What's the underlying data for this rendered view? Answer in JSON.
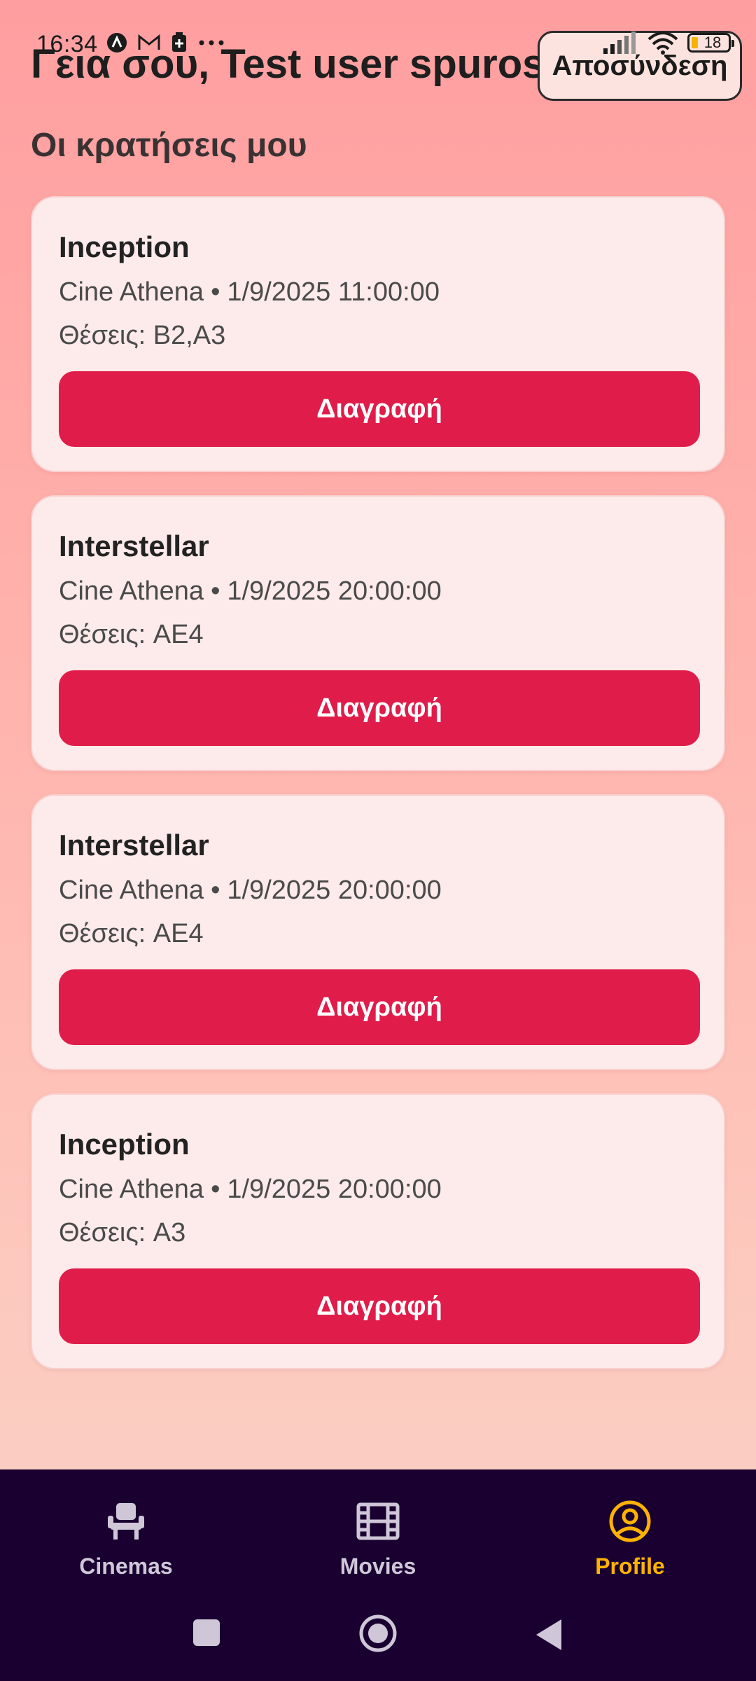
{
  "status": {
    "time": "16:34",
    "battery": "18"
  },
  "header": {
    "greeting": "Γεια σου, Test user spuros",
    "logout_label": "Αποσύνδεση",
    "section_title": "Οι κρατήσεις μου"
  },
  "bookings": [
    {
      "movie": "Inception",
      "cinema": "Cine Athena",
      "datetime": "1/9/2025 11:00:00",
      "seats": "Θέσεις: B2,A3",
      "delete_label": "Διαγραφή"
    },
    {
      "movie": "Interstellar",
      "cinema": "Cine Athena",
      "datetime": "1/9/2025 20:00:00",
      "seats": "Θέσεις: AE4",
      "delete_label": "Διαγραφή"
    },
    {
      "movie": "Interstellar",
      "cinema": "Cine Athena",
      "datetime": "1/9/2025 20:00:00",
      "seats": "Θέσεις: AE4",
      "delete_label": "Διαγραφή"
    },
    {
      "movie": "Inception",
      "cinema": "Cine Athena",
      "datetime": "1/9/2025 20:00:00",
      "seats": "Θέσεις: A3",
      "delete_label": "Διαγραφή"
    }
  ],
  "separator": "•",
  "bottom_nav": {
    "items": [
      {
        "label": "Cinemas",
        "icon": "seat-icon",
        "active": false
      },
      {
        "label": "Movies",
        "icon": "film-icon",
        "active": false
      },
      {
        "label": "Profile",
        "icon": "profile-icon",
        "active": true
      }
    ],
    "active_color": "#ffb300",
    "background": "#1a0030"
  },
  "colors": {
    "delete_button": "#e01d4a",
    "card_background": "#fdeaea"
  }
}
